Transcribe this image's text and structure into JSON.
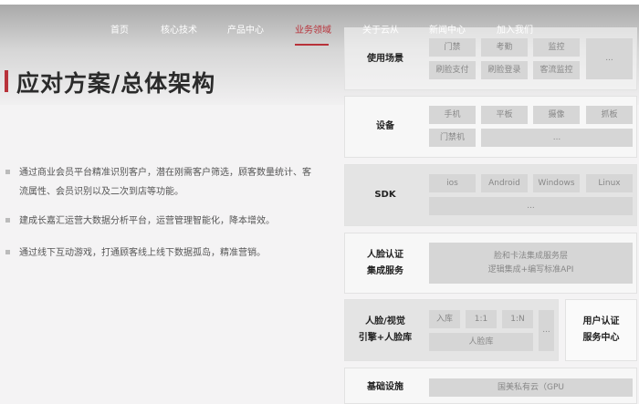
{
  "nav": [
    "首页",
    "核心技术",
    "产品中心",
    "业务领域",
    "关于云从",
    "新闻中心",
    "加入我们"
  ],
  "title": "应对方案/总体架构",
  "bullets": [
    "通过商业会员平台精准识别客户，潜在刚需客户筛选，顾客数量统计、客流属性、会员识别以及二次到店等功能。",
    "建成长嘉汇运营大数据分析平台，运营管理智能化，降本增效。",
    "通过线下互动游戏，打通顾客线上线下数据孤岛，精准营销。"
  ],
  "rows": {
    "scene": {
      "label": "使用场景",
      "cells": [
        "门禁",
        "考勤",
        "监控",
        "刷脸支付",
        "刷脸登录",
        "客流监控",
        "..."
      ]
    },
    "device": {
      "label": "设备",
      "cells": [
        "手机",
        "平板",
        "摄像",
        "抓板",
        "门禁机",
        "..."
      ]
    },
    "sdk": {
      "label": "SDK",
      "cells": [
        "ios",
        "Android",
        "Windows",
        "Linux",
        "..."
      ]
    },
    "auth": {
      "label1": "人脸认证",
      "label2": "集成服务",
      "line1": "脸和卡法集成服务层",
      "line2": "逻辑集成+编写标准API"
    },
    "engine": {
      "label1": "人脸/视觉",
      "label2": "引擎+人脸库",
      "cells": [
        "入库",
        "1:1",
        "1:N",
        "...",
        "人脸库"
      ]
    },
    "center": {
      "label1": "用户认证",
      "label2": "服务中心"
    },
    "infra": {
      "label": "基础设施",
      "cell": "国美私有云（GPU"
    }
  }
}
